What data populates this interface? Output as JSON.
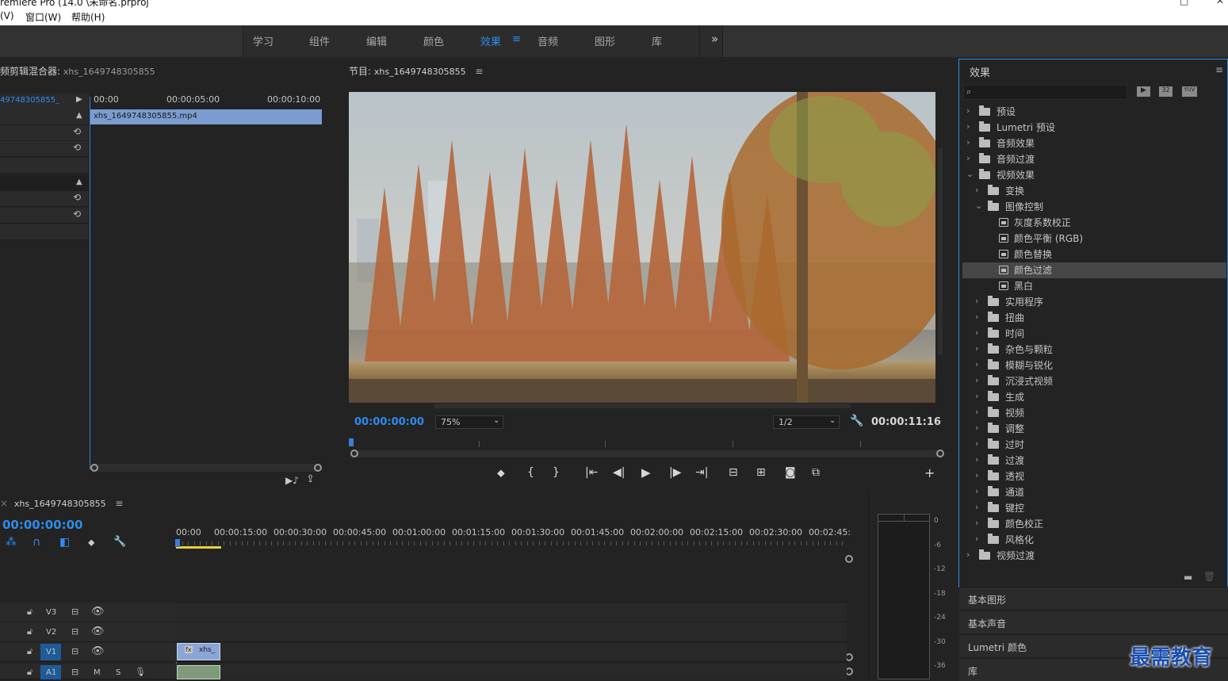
{
  "titlebar": {
    "title": "remiere Pro (14.0 \\未命名.prproj",
    "menu": [
      "(V)",
      "窗口(W)",
      "帮助(H)"
    ],
    "controls": [
      "□",
      "✕"
    ]
  },
  "workspaces": {
    "tabs": [
      "学习",
      "组件",
      "编辑",
      "颜色",
      "效果",
      "音频",
      "图形",
      "库"
    ],
    "active": "效果",
    "menu_icon": "≡",
    "more": "»"
  },
  "source_panel": {
    "title": "频剪辑混合器:",
    "clip": "xhs_1649748305855",
    "track_name": "49748305855_",
    "times": [
      "00:00",
      "00:00:05:00",
      "00:00:10:00"
    ],
    "clip_label": "xhs_1649748305855.mp4"
  },
  "program": {
    "title": "节目:",
    "sequence": "xhs_1649748305855",
    "menu_icon": "≡",
    "timecode": "00:00:00:00",
    "zoom": "75%",
    "resolution": "1/2",
    "duration": "00:00:11:16",
    "playhead_fraction": 0
  },
  "effects": {
    "title": "效果",
    "menu_icon": "≡",
    "search_placeholder": "",
    "badges": [
      "32",
      "YUV"
    ],
    "items": [
      {
        "label": "预设",
        "level": 0,
        "type": "folder",
        "open": false
      },
      {
        "label": "Lumetri 预设",
        "level": 0,
        "type": "folder",
        "open": false
      },
      {
        "label": "音频效果",
        "level": 0,
        "type": "folder",
        "open": false
      },
      {
        "label": "音频过渡",
        "level": 0,
        "type": "folder",
        "open": false
      },
      {
        "label": "视频效果",
        "level": 0,
        "type": "folder",
        "open": true
      },
      {
        "label": "变换",
        "level": 1,
        "type": "folder",
        "open": false
      },
      {
        "label": "图像控制",
        "level": 1,
        "type": "folder",
        "open": true
      },
      {
        "label": "灰度系数校正",
        "level": 2,
        "type": "fx"
      },
      {
        "label": "颜色平衡 (RGB)",
        "level": 2,
        "type": "fx"
      },
      {
        "label": "颜色替换",
        "level": 2,
        "type": "fx"
      },
      {
        "label": "颜色过滤",
        "level": 2,
        "type": "fx",
        "selected": true
      },
      {
        "label": "黑白",
        "level": 2,
        "type": "fx"
      },
      {
        "label": "实用程序",
        "level": 1,
        "type": "folder",
        "open": false
      },
      {
        "label": "扭曲",
        "level": 1,
        "type": "folder",
        "open": false
      },
      {
        "label": "时间",
        "level": 1,
        "type": "folder",
        "open": false
      },
      {
        "label": "杂色与颗粒",
        "level": 1,
        "type": "folder",
        "open": false
      },
      {
        "label": "模糊与锐化",
        "level": 1,
        "type": "folder",
        "open": false
      },
      {
        "label": "沉浸式视频",
        "level": 1,
        "type": "folder",
        "open": false
      },
      {
        "label": "生成",
        "level": 1,
        "type": "folder",
        "open": false
      },
      {
        "label": "视频",
        "level": 1,
        "type": "folder",
        "open": false
      },
      {
        "label": "调整",
        "level": 1,
        "type": "folder",
        "open": false
      },
      {
        "label": "过时",
        "level": 1,
        "type": "folder",
        "open": false
      },
      {
        "label": "过渡",
        "level": 1,
        "type": "folder",
        "open": false
      },
      {
        "label": "透视",
        "level": 1,
        "type": "folder",
        "open": false
      },
      {
        "label": "通道",
        "level": 1,
        "type": "folder",
        "open": false
      },
      {
        "label": "键控",
        "level": 1,
        "type": "folder",
        "open": false
      },
      {
        "label": "颜色校正",
        "level": 1,
        "type": "folder",
        "open": false
      },
      {
        "label": "风格化",
        "level": 1,
        "type": "folder",
        "open": false
      },
      {
        "label": "视频过渡",
        "level": 0,
        "type": "folder",
        "open": false
      }
    ]
  },
  "side_panels": [
    "基本图形",
    "基本声音",
    "Lumetri 颜色",
    "库"
  ],
  "timeline": {
    "sequence": "xhs_1649748305855",
    "menu_icon": "≡",
    "timecode": "00:00:00:00",
    "ruler": [
      "00:00",
      "00:00:15:00",
      "00:00:30:00",
      "00:00:45:00",
      "00:01:00:00",
      "00:01:15:00",
      "00:01:30:00",
      "00:01:45:00",
      "00:02:00:00",
      "00:02:15:00",
      "00:02:30:00",
      "00:02:45:"
    ],
    "tracks": [
      "V3",
      "V2",
      "V1",
      "A1"
    ],
    "a1_buttons": [
      "M",
      "S"
    ],
    "clip_label": "xhs_",
    "fx_badge": "fx"
  },
  "meter": {
    "scale": [
      "0",
      "-6",
      "-12",
      "-18",
      "-24",
      "-30",
      "-36"
    ]
  },
  "watermark": "最需教育"
}
